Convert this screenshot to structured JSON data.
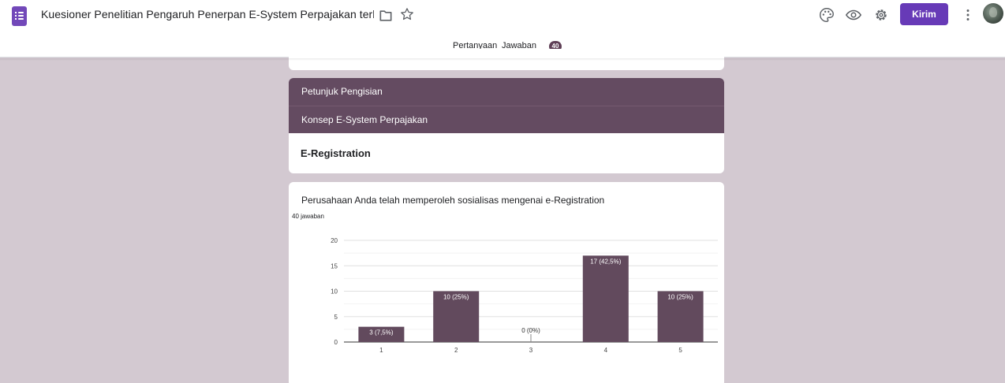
{
  "header": {
    "doc_title": "Kuesioner Penelitian Pengaruh Penerpan E-System Perpajakan terhadap Kepatuhan Wajib Pajak",
    "send_label": "Kirim",
    "icons": [
      "forms-logo-icon",
      "folder-icon",
      "star-icon",
      "palette-icon",
      "preview-eye-icon",
      "settings-gear-icon",
      "more-vert-icon",
      "avatar"
    ]
  },
  "tabs": {
    "questions_label": "Pertanyaan",
    "answers_label": "Jawaban",
    "answers_count": "40"
  },
  "sections": {
    "section1_title": "Petunjuk Pengisian",
    "section2_title": "Konsep E-System Perpajakan",
    "subsection_title": "E-Registration"
  },
  "question": {
    "title": "Perusahaan Anda telah memperoleh sosialisas mengenai e-Registration",
    "response_count": "40 jawaban"
  },
  "colors": {
    "accent": "#673ab7",
    "theme": "#644b61",
    "background": "#d3c9d1",
    "bar": "#624a5d"
  },
  "chart_data": {
    "type": "bar",
    "categories": [
      "1",
      "2",
      "3",
      "4",
      "5"
    ],
    "values": [
      3,
      10,
      0,
      17,
      10
    ],
    "data_labels": [
      "3 (7,5%)",
      "10 (25%)",
      "0 (0%)",
      "17 (42,5%)",
      "10 (25%)"
    ],
    "y_ticks": [
      "0",
      "5",
      "10",
      "15",
      "20"
    ],
    "ylim": [
      0,
      20
    ],
    "grid": true,
    "legend": "none"
  }
}
